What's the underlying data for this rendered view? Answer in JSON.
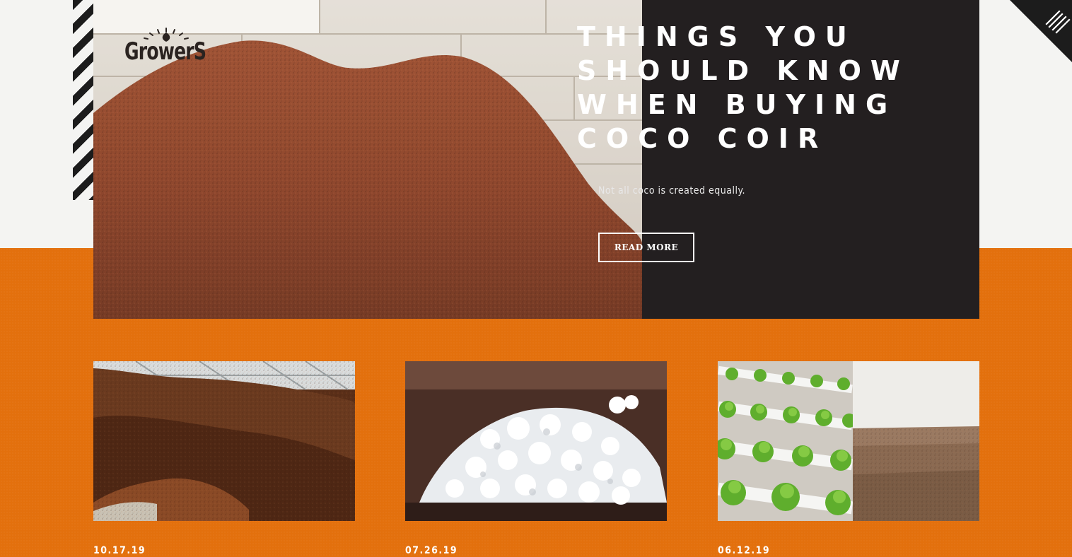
{
  "brand": {
    "logo_text": "GrowerS"
  },
  "hero": {
    "title": "THINGS YOU SHOULD KNOW WHEN BUYING COCO COIR",
    "subtitle": "Not all coco is created equally.",
    "cta_label": "READ MORE"
  },
  "posts": [
    {
      "date": "10.17.19",
      "image": "coco-coir-pile-photo"
    },
    {
      "date": "07.26.19",
      "image": "perlite-photo"
    },
    {
      "date": "06.12.19",
      "image": "hydroponic-lettuce-and-soil-field-photo"
    }
  ],
  "icons": {
    "menu": "menu-lines-icon",
    "logo_sun": "sunrise-leaf-icon"
  },
  "colors": {
    "accent_orange": "#e3700d",
    "panel_dark": "#231f20",
    "background": "#f4f4f2"
  }
}
